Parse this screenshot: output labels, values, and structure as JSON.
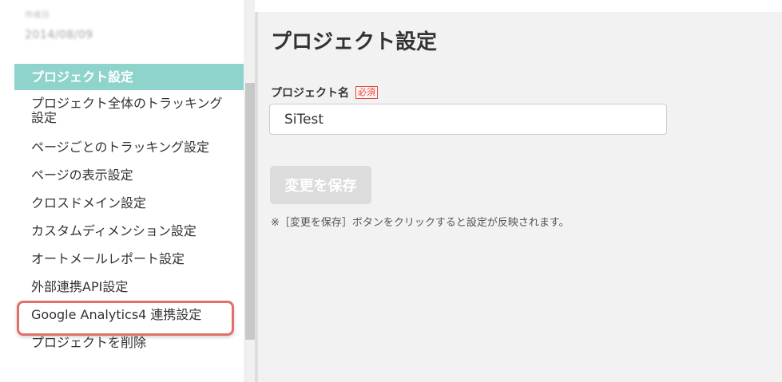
{
  "sidebar": {
    "meta_label": "作成日",
    "meta_date": "2014/08/09",
    "items": [
      {
        "label": "プロジェクト設定"
      },
      {
        "label": "プロジェクト全体のトラッキング設定"
      },
      {
        "label": "ページごとのトラッキング設定"
      },
      {
        "label": "ページの表示設定"
      },
      {
        "label": "クロスドメイン設定"
      },
      {
        "label": "カスタムディメンション設定"
      },
      {
        "label": "オートメールレポート設定"
      },
      {
        "label": "外部連携API設定"
      },
      {
        "label": "Google Analytics4 連携設定"
      },
      {
        "label": "プロジェクトを削除"
      }
    ]
  },
  "main": {
    "title": "プロジェクト設定",
    "field_label": "プロジェクト名",
    "required_badge": "必須",
    "project_name_value": "SiTest",
    "save_label": "変更を保存",
    "note": "※［変更を保存］ボタンをクリックすると設定が反映されます。"
  },
  "colors": {
    "active_nav_bg": "#8fd4cc",
    "highlight_ring": "#e07168",
    "required": "#e0483e",
    "disabled_button": "#dcdcdc"
  }
}
